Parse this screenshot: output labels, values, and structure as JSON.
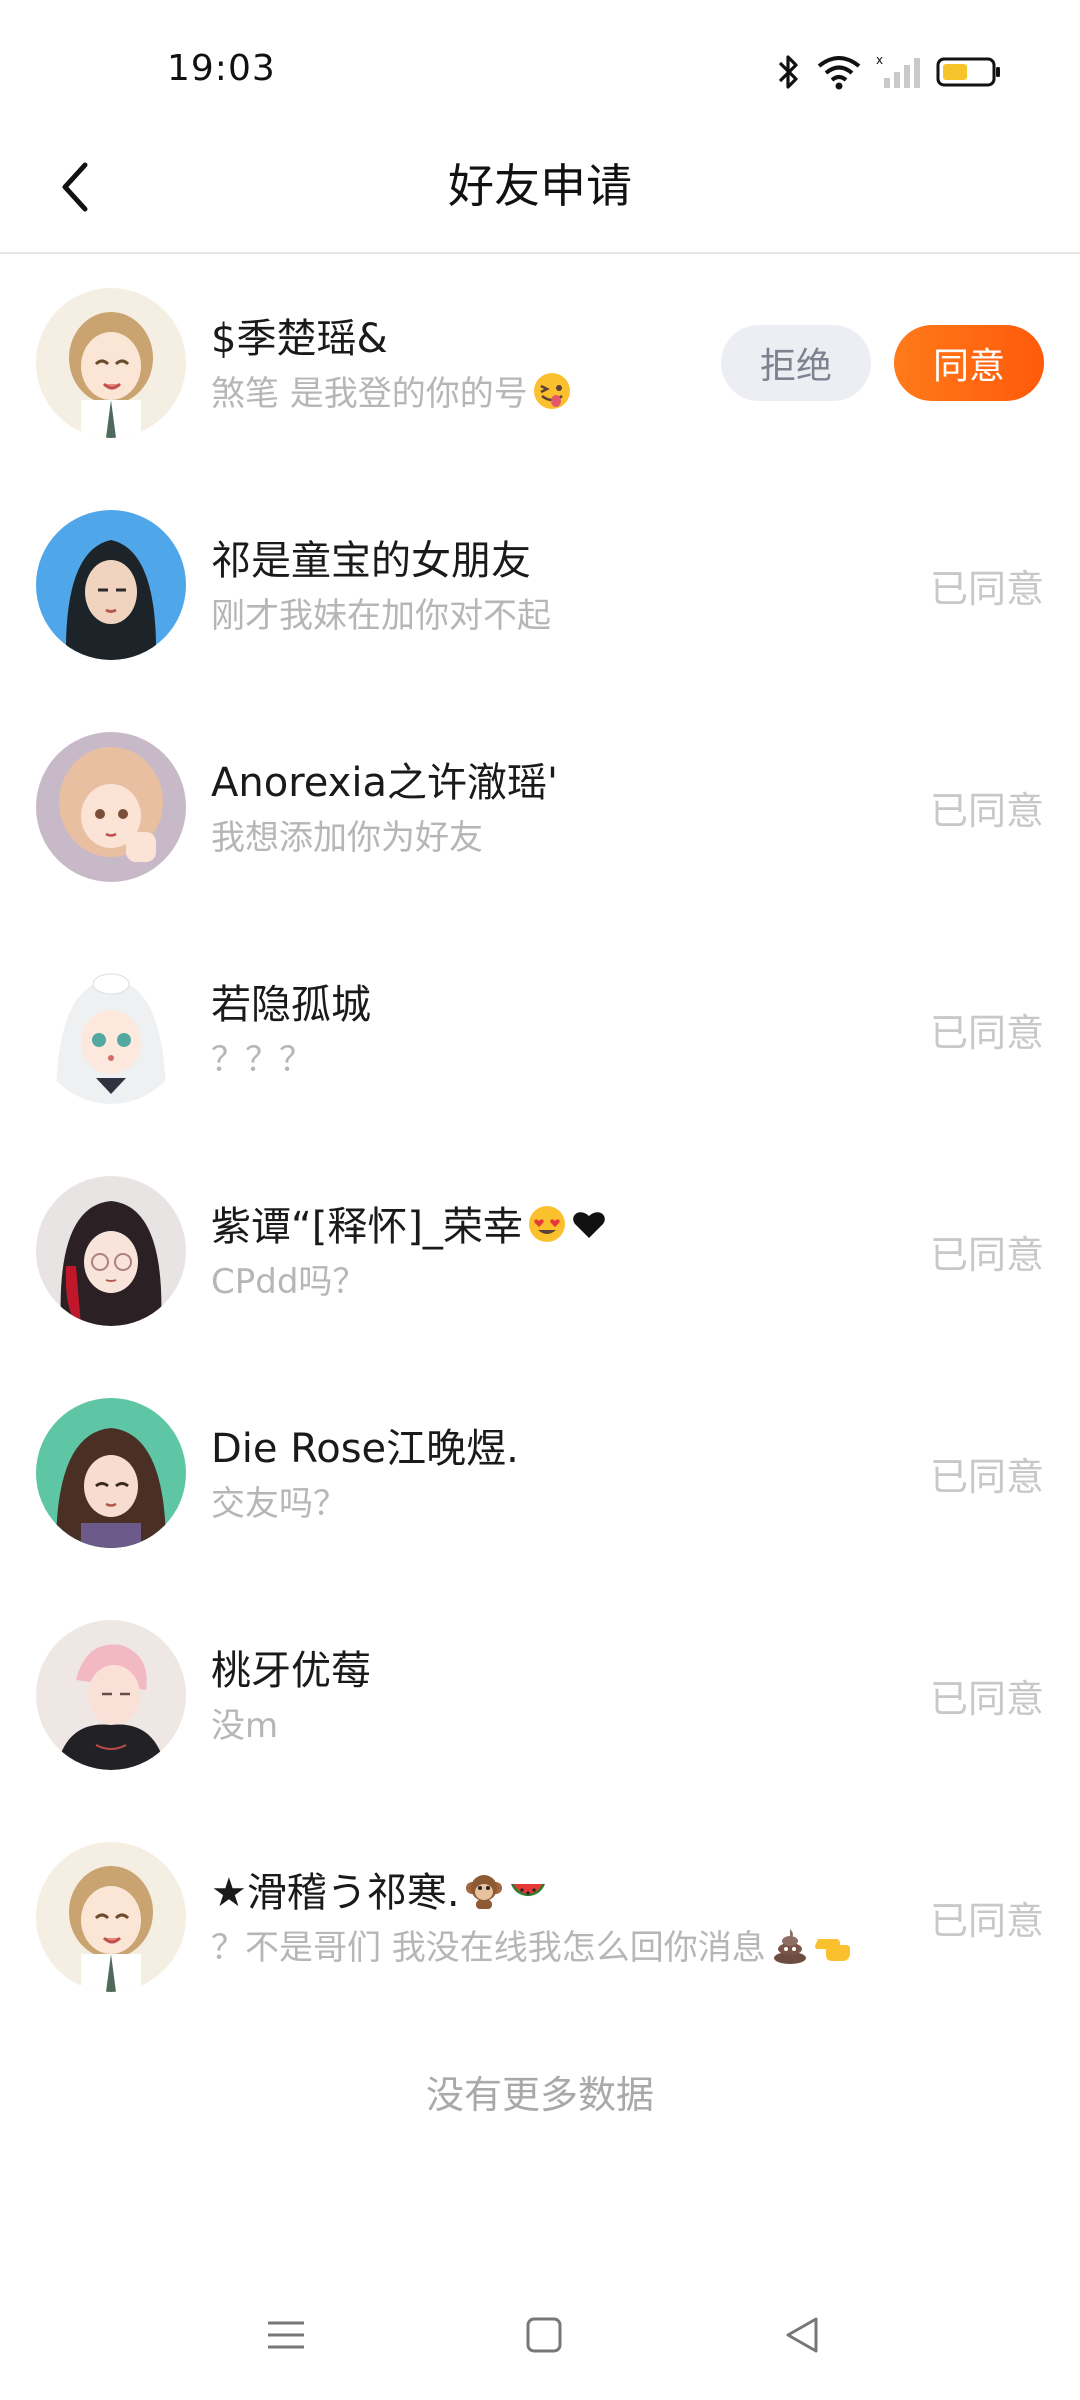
{
  "status_bar": {
    "time": "19:03",
    "battery_color": "#f7c52b"
  },
  "header": {
    "title": "好友申请",
    "back_icon": "chevron-left-icon"
  },
  "requests": [
    {
      "name": "$季楚瑶&",
      "message": "煞笔 是我登的你的号",
      "emoji": "face-tongue",
      "state": "pending",
      "reject_label": "拒绝",
      "accept_label": "同意"
    },
    {
      "name": "祁是童宝的女朋友",
      "message": "刚才我妹在加你对不起",
      "state": "agreed",
      "status_label": "已同意"
    },
    {
      "name": "Anorexia之许澈瑶'",
      "message": "我想添加你为好友",
      "state": "agreed",
      "status_label": "已同意"
    },
    {
      "name": "若隐孤城",
      "message": "？？？",
      "state": "agreed",
      "status_label": "已同意"
    },
    {
      "name": "紫谭“[释怀]_荣幸",
      "message": "CPdd吗？",
      "emoji": "heart-eyes-and-black-heart",
      "state": "agreed",
      "status_label": "已同意"
    },
    {
      "name": "Die Rose江晚煜.",
      "message": "交友吗？",
      "state": "agreed",
      "status_label": "已同意"
    },
    {
      "name": "桃牙优莓",
      "message": "没m",
      "state": "agreed",
      "status_label": "已同意"
    },
    {
      "name": "★滑稽う祁寒.",
      "message": "？不是哥们 我没在线我怎么回你消息",
      "emoji": "monkey-watermelon-poop-point",
      "state": "agreed",
      "status_label": "已同意"
    }
  ],
  "footer": {
    "no_more": "没有更多数据"
  },
  "colors": {
    "accent": "#ff6410",
    "reject_bg": "#eceef3",
    "muted_text": "#b6b6b6"
  }
}
